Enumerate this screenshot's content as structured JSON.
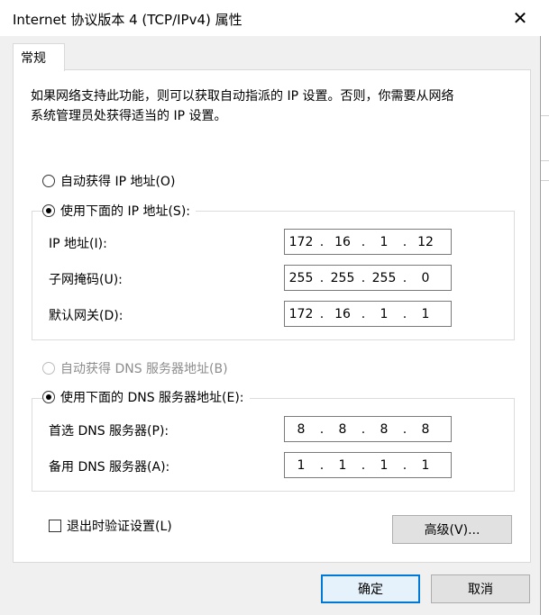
{
  "window": {
    "title": "Internet 协议版本 4 (TCP/IPv4) 属性",
    "close_glyph": "✕"
  },
  "tabs": [
    {
      "label": "常规"
    }
  ],
  "description": {
    "line1": "如果网络支持此功能，则可以获取自动指派的 IP 设置。否则，你需要从网络",
    "line2": "系统管理员处获得适当的 IP 设置。"
  },
  "ip_section": {
    "auto_radio": {
      "label": "自动获得 IP 地址(O)",
      "selected": false
    },
    "manual_radio": {
      "label": "使用下面的 IP 地址(S):",
      "selected": true
    },
    "fields": [
      {
        "label": "IP 地址(I):",
        "octets": [
          "172",
          "16",
          "1",
          "12"
        ]
      },
      {
        "label": "子网掩码(U):",
        "octets": [
          "255",
          "255",
          "255",
          "0"
        ]
      },
      {
        "label": "默认网关(D):",
        "octets": [
          "172",
          "16",
          "1",
          "1"
        ]
      }
    ]
  },
  "dns_section": {
    "auto_radio": {
      "label": "自动获得 DNS 服务器地址(B)",
      "selected": false,
      "disabled": true
    },
    "manual_radio": {
      "label": "使用下面的 DNS 服务器地址(E):",
      "selected": true
    },
    "fields": [
      {
        "label": "首选 DNS 服务器(P):",
        "octets": [
          "8",
          "8",
          "8",
          "8"
        ]
      },
      {
        "label": "备用 DNS 服务器(A):",
        "octets": [
          "1",
          "1",
          "1",
          "1"
        ]
      }
    ]
  },
  "validate_checkbox": {
    "label": "退出时验证设置(L)",
    "checked": false
  },
  "buttons": {
    "advanced": "高级(V)...",
    "ok": "确定",
    "cancel": "取消"
  },
  "colors": {
    "accent": "#0078d7",
    "dialog_bg": "#f0f0f0",
    "panel_bg": "#ffffff"
  }
}
